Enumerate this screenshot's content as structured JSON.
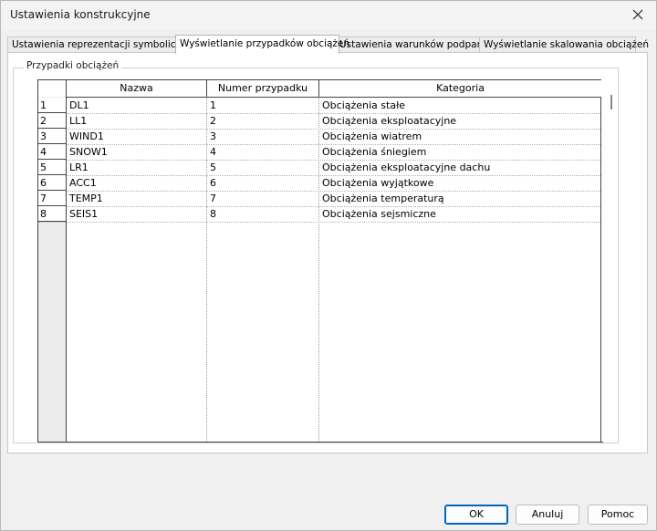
{
  "window": {
    "title": "Ustawienia konstrukcyjne"
  },
  "tabs": [
    {
      "label": "Ustawienia reprezentacji symbolicznej"
    },
    {
      "label": "Wyświetlanie przypadków obciążeń",
      "active": true
    },
    {
      "label": "Ustawienia warunków podparcia"
    },
    {
      "label": "Wyświetlanie skalowania obciążeń"
    }
  ],
  "group": {
    "title": "Przypadki obciążeń"
  },
  "table": {
    "columns": [
      "Nazwa",
      "Numer przypadku",
      "Kategoria"
    ],
    "rows": [
      {
        "n": "1",
        "name": "DL1",
        "num": "1",
        "cat": "Obciążenia stałe"
      },
      {
        "n": "2",
        "name": "LL1",
        "num": "2",
        "cat": "Obciążenia eksploatacyjne"
      },
      {
        "n": "3",
        "name": "WIND1",
        "num": "3",
        "cat": "Obciążenia wiatrem"
      },
      {
        "n": "4",
        "name": "SNOW1",
        "num": "4",
        "cat": "Obciążenia śniegiem"
      },
      {
        "n": "5",
        "name": "LR1",
        "num": "5",
        "cat": "Obciążenia eksploatacyjne dachu"
      },
      {
        "n": "6",
        "name": "ACC1",
        "num": "6",
        "cat": "Obciążenia wyjątkowe"
      },
      {
        "n": "7",
        "name": "TEMP1",
        "num": "7",
        "cat": "Obciążenia temperaturą"
      },
      {
        "n": "8",
        "name": "SEIS1",
        "num": "8",
        "cat": "Obciążenia sejsmiczne"
      }
    ]
  },
  "buttons": {
    "ok": "OK",
    "cancel": "Anuluj",
    "help": "Pomoc"
  },
  "icons": {
    "close": "close-icon"
  },
  "colors": {
    "accent": "#0067c0"
  }
}
